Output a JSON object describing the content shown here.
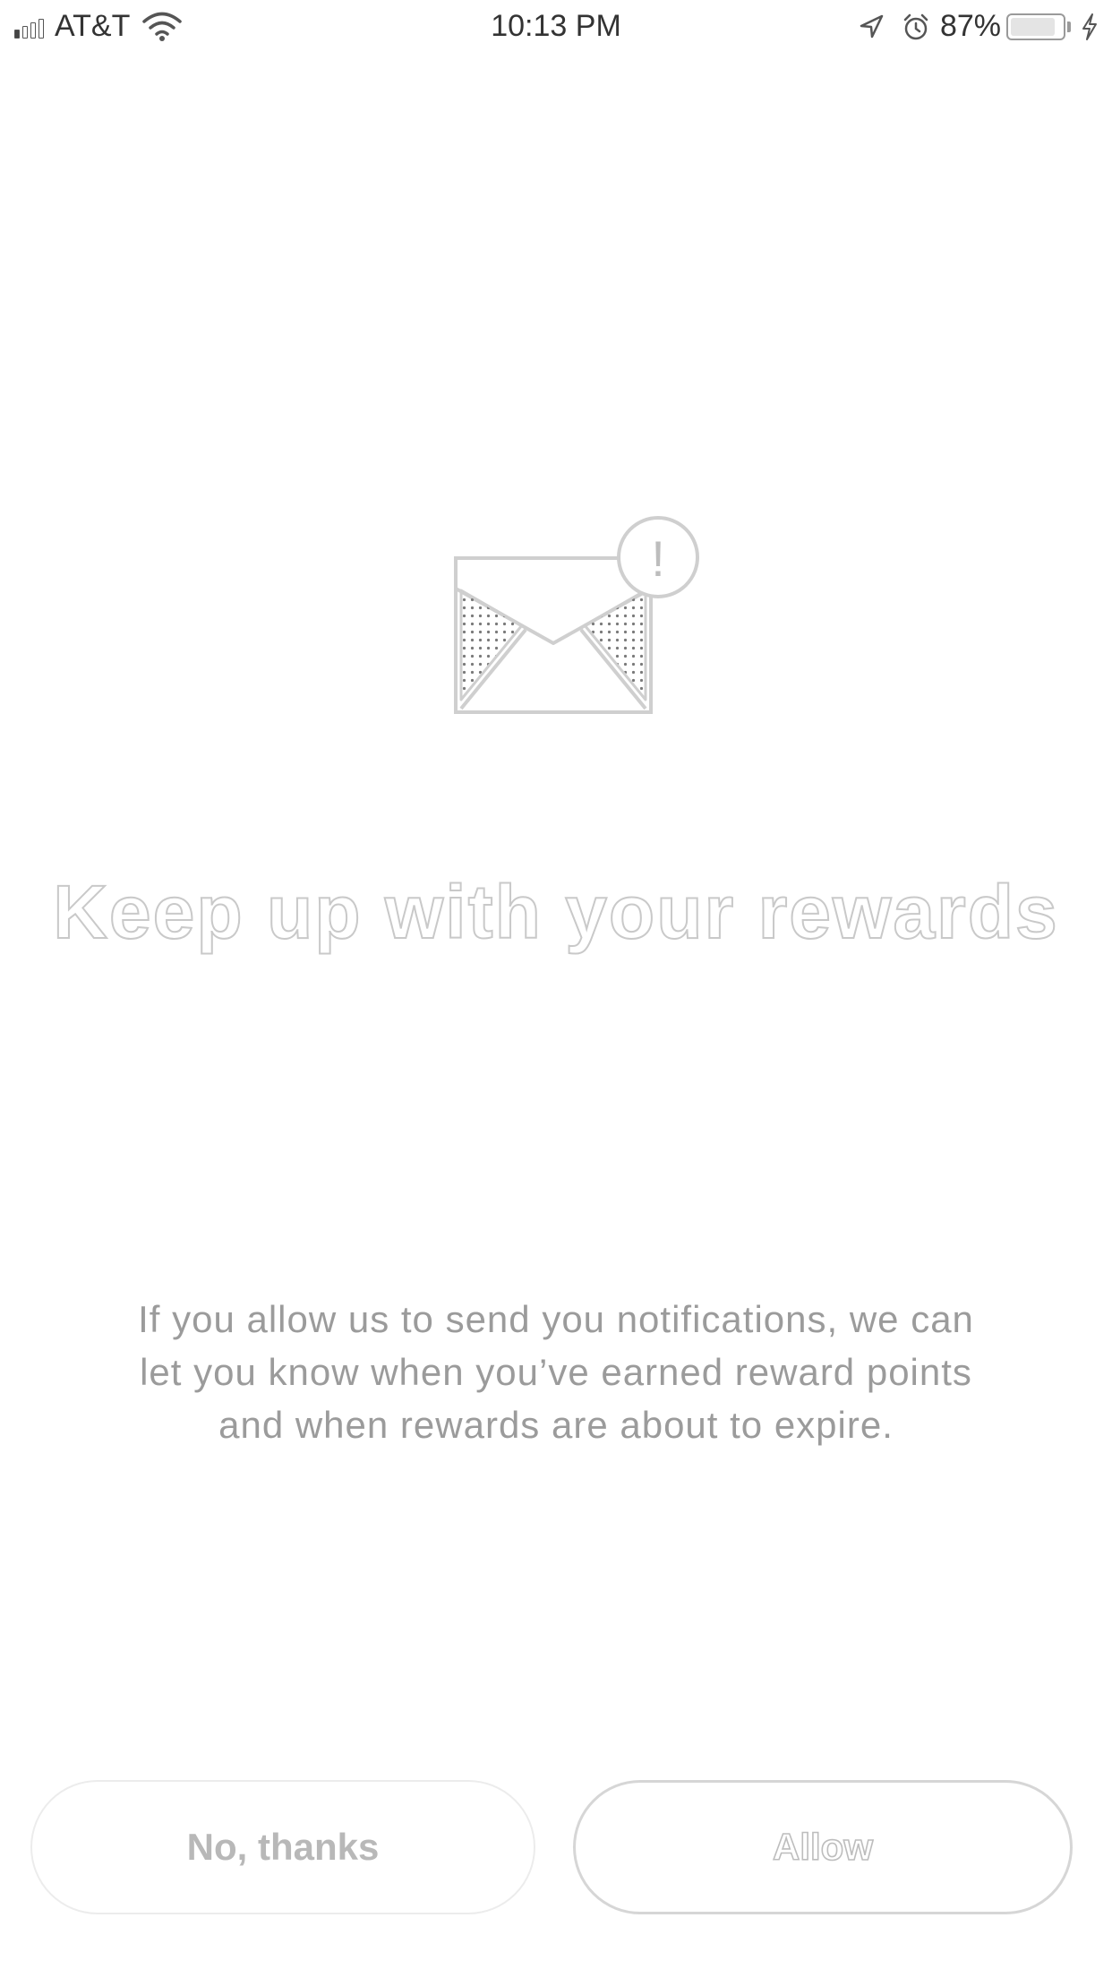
{
  "status_bar": {
    "carrier": "AT&T",
    "time": "10:13 PM",
    "battery_percent": "87%",
    "battery_level": 0.87,
    "signal_bars_on": 1,
    "icons": [
      "signal-icon",
      "wifi-icon",
      "location-arrow-icon",
      "alarm-icon",
      "battery-icon",
      "charging-bolt-icon"
    ]
  },
  "illustration": {
    "icon": "envelope-alert-icon",
    "badge_text": "!"
  },
  "title": "Keep up with your rewards",
  "body": {
    "line1": "If you allow us to send you notifications, we can",
    "line2": "let you know when you’ve earned reward points",
    "line3": "and when rewards are about to expire."
  },
  "buttons": {
    "decline_label": "No, thanks",
    "allow_label": "Allow"
  }
}
